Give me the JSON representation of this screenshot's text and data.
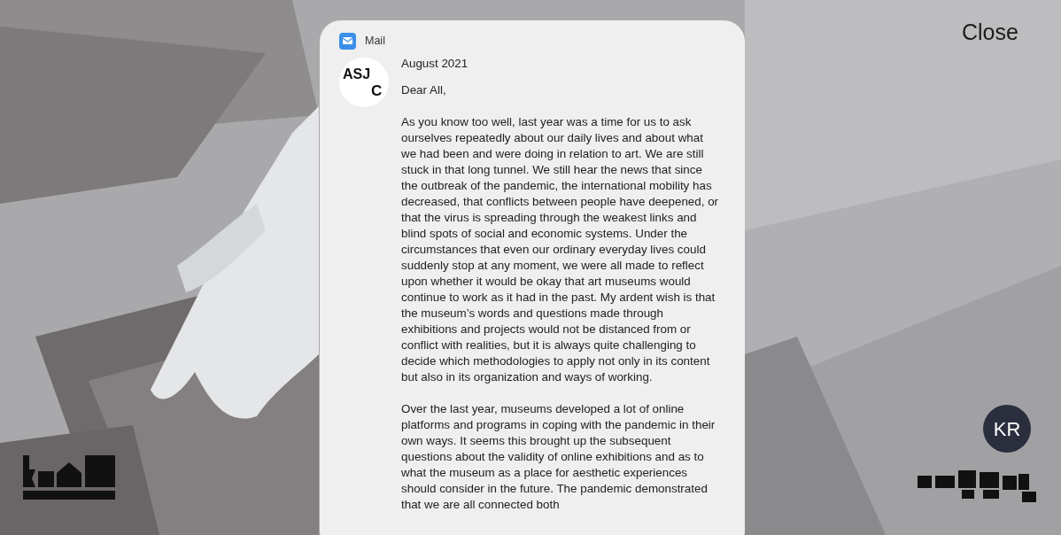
{
  "close_button": {
    "label": "Close"
  },
  "language_button": {
    "label": "KR"
  },
  "mail": {
    "app": "Mail",
    "sender_avatar": {
      "line_1": "ASJ",
      "line_2": "C"
    },
    "date": "August 2021",
    "greeting": "Dear All,",
    "paragraphs": [
      "As you know too well, last year was a time for us to ask ourselves repeatedly about our daily lives and about what we had been and were doing in relation to art. We are still stuck in that long tunnel. We still hear the news that since the outbreak of the pandemic, the international mobility has decreased, that conflicts between people have deepened, or that the virus is spreading through the weakest links and blind spots of social and economic systems. Under the circumstances that even our ordinary everyday lives could suddenly stop at any moment, we were all made to reflect upon whether it would be okay that art museums would continue to work as it had in the past. My ardent wish is that the museum’s words and questions made through exhibitions and projects would not be distanced from or conflict with realities, but it is always quite challenging to decide which methodologies to apply not only in its content but also in its organization and ways of working.",
      "Over the last year, museums developed a lot of online platforms and programs in coping with the pandemic in their own ways. It seems this brought up the subsequent questions about the validity of online exhibitions and as to what the museum as a place for aesthetic experiences should consider in the future. The pandemic demonstrated that we are all connected both"
    ]
  }
}
